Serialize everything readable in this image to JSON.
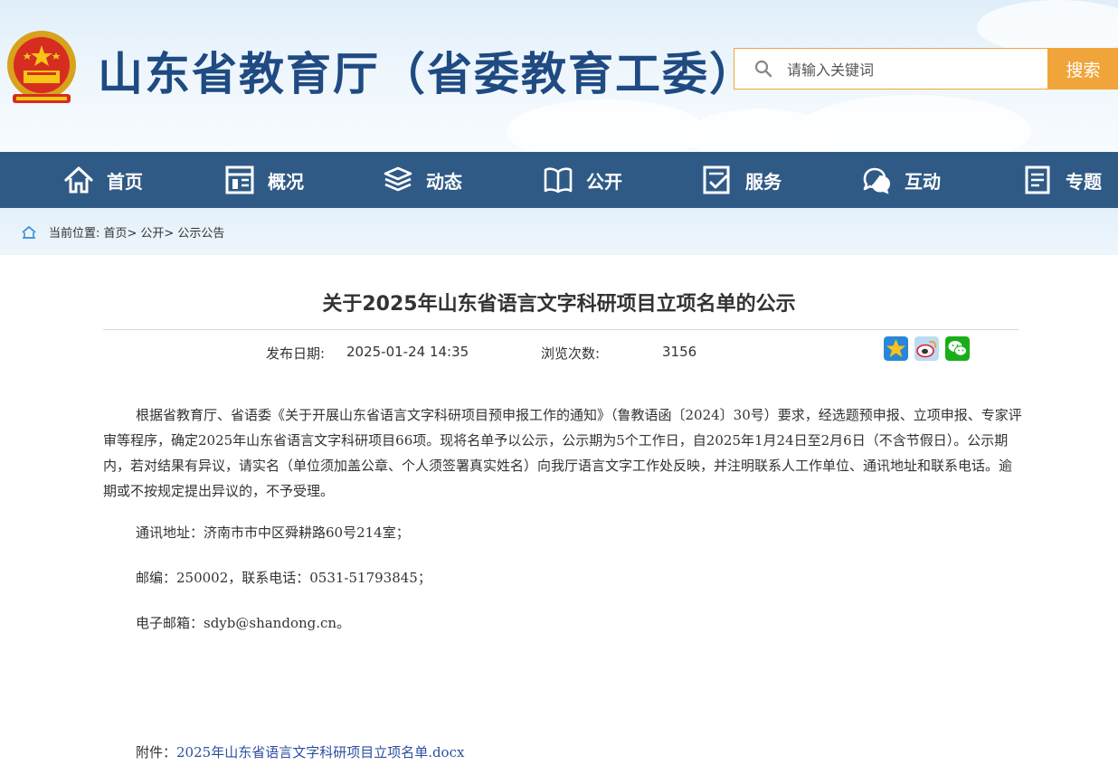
{
  "header": {
    "site_title": "山东省教育厅（省委教育工委）",
    "search": {
      "placeholder": "请输入关键词",
      "button_label": "搜索"
    }
  },
  "nav": {
    "items": [
      {
        "label": "首页",
        "icon": "home-icon"
      },
      {
        "label": "概况",
        "icon": "overview-icon"
      },
      {
        "label": "动态",
        "icon": "news-stack-icon"
      },
      {
        "label": "公开",
        "icon": "open-book-icon"
      },
      {
        "label": "服务",
        "icon": "service-icon"
      },
      {
        "label": "互动",
        "icon": "chat-bubbles-icon"
      },
      {
        "label": "专题",
        "icon": "document-icon"
      }
    ]
  },
  "breadcrumb": {
    "prefix": "当前位置: ",
    "items": [
      "首页>",
      "公开>",
      "公示公告"
    ]
  },
  "article": {
    "title": "关于2025年山东省语言文字科研项目立项名单的公示",
    "publish_label": "发布日期:",
    "publish_date": "2025-01-24 14:35",
    "views_label": "浏览次数:",
    "views": "3156",
    "share_icons": [
      "star-share-icon",
      "weibo-icon",
      "wechat-icon"
    ],
    "paragraph": "根据省教育厅、省语委《关于开展山东省语言文字科研项目预申报工作的通知》（鲁教语函〔2024〕30号）要求，经选题预申报、立项申报、专家评审等程序，确定2025年山东省语言文字科研项目66项。现将名单予以公示，公示期为5个工作日，自2025年1月24日至2月6日（不含节假日）。公示期内，若对结果有异议，请实名（单位须加盖公章、个人须签署真实姓名）向我厅语言文字工作处反映，并注明联系人工作单位、通讯地址和联系电话。逾期或不按规定提出异议的，不予受理。",
    "address": "通讯地址：济南市市中区舜耕路60号214室；",
    "postcode": "邮编：250002，联系电话：0531-51793845；",
    "email": "电子邮箱：sdyb@shandong.cn。",
    "attachment_label": "附件：",
    "attachment_link": "2025年山东省语言文字科研项目立项名单.docx"
  },
  "colors": {
    "nav_bg": "#2f5a86",
    "title_blue": "#1f4a82",
    "search_orange": "#f1a43a",
    "link_blue": "#2d4fa0"
  }
}
